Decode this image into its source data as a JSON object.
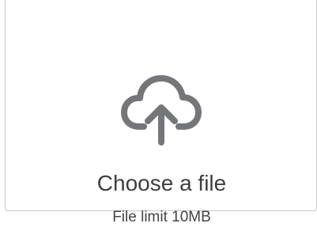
{
  "upload": {
    "icon": "cloud-upload-icon",
    "title": "Choose a file",
    "hint": "File limit 10MB"
  },
  "colors": {
    "icon": "#74767a",
    "border": "#c8c8c8",
    "text": "#3f3f3f"
  }
}
